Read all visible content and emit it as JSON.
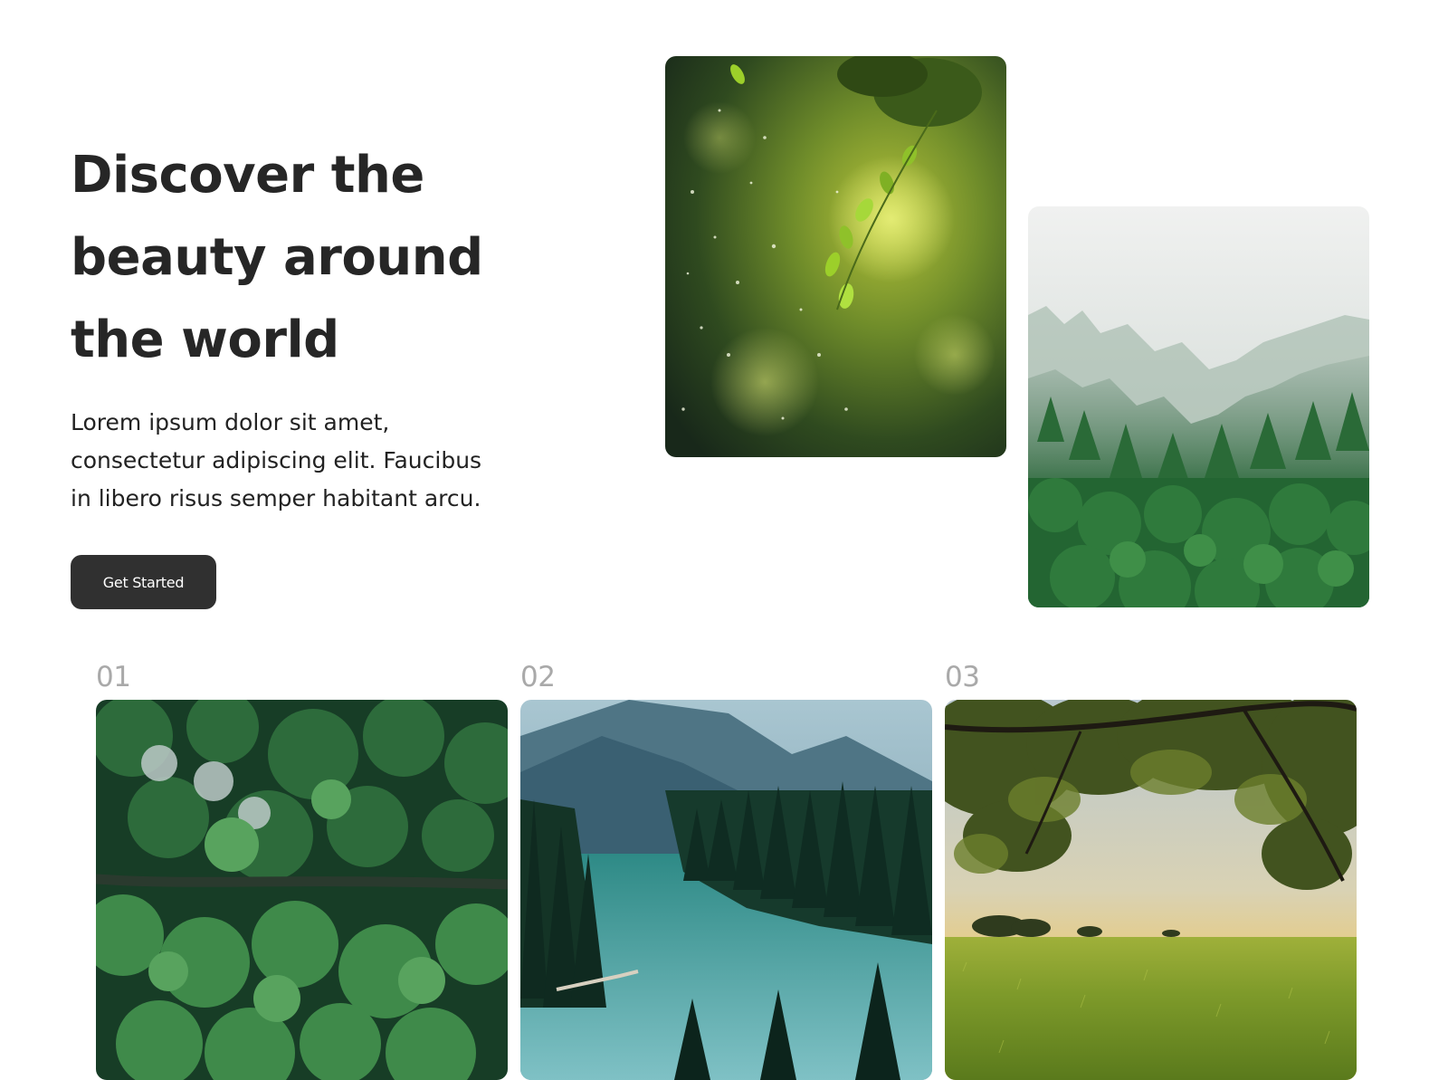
{
  "hero": {
    "title_lines": [
      "Discover the",
      "beauty around",
      "the world"
    ],
    "text_lines": [
      "Lorem ipsum dolor sit amet,",
      "consectetur adipiscing elit. Faucibus",
      "in libero risus semper habitant arcu."
    ],
    "cta_label": "Get Started"
  },
  "gallery": {
    "items": [
      {
        "number": "01"
      },
      {
        "number": "02"
      },
      {
        "number": "03"
      }
    ]
  }
}
